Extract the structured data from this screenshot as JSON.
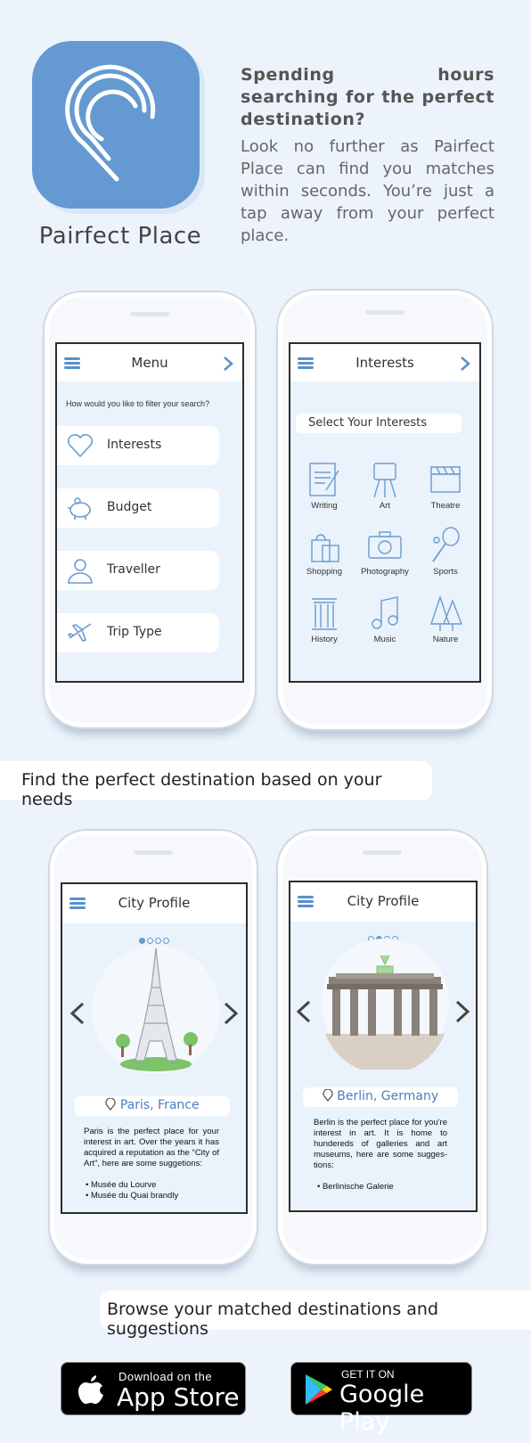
{
  "hero": {
    "app_name": "Pairfect Place",
    "headline": "Spending hours searching for the perfect destination?",
    "blurb": "Look no further as Pairfect Place can find you matches within seconds. You’re just a tap away from your perfect place."
  },
  "menu_screen": {
    "title": "Menu",
    "question": "How would you like to filter your search?",
    "items": [
      {
        "label": "Interests",
        "icon": "heart-icon"
      },
      {
        "label": "Budget",
        "icon": "piggy-bank-icon"
      },
      {
        "label": "Traveller",
        "icon": "person-icon"
      },
      {
        "label": "Trip Type",
        "icon": "airplane-icon"
      }
    ]
  },
  "interests_screen": {
    "title": "Interests",
    "select_label": "Select Your Interests",
    "items": [
      {
        "label": "Writing",
        "icon": "writing-icon"
      },
      {
        "label": "Art",
        "icon": "easel-icon"
      },
      {
        "label": "Theatre",
        "icon": "clapperboard-icon"
      },
      {
        "label": "Shopping",
        "icon": "shopping-bag-icon"
      },
      {
        "label": "Photography",
        "icon": "camera-icon"
      },
      {
        "label": "Sports",
        "icon": "tennis-racket-icon"
      },
      {
        "label": "History",
        "icon": "column-icon"
      },
      {
        "label": "Music",
        "icon": "music-note-icon"
      },
      {
        "label": "Nature",
        "icon": "tree-icon"
      }
    ]
  },
  "banner1": "Find the perfect destination based on your needs",
  "city1": {
    "title": "City Profile",
    "city": "Paris, France",
    "description": "Paris is the perfect place for your interest in art. Over the years it has acquired a reputation as the “City of Art”, here are some suggetions:",
    "suggestions": [
      "Musée du Lourve",
      "Musée du Quai brandly"
    ]
  },
  "city2": {
    "title": "City Profile",
    "city": "Berlin, Germany",
    "description": "Berlin is the perfect place for you're interest in art. It is home to hundereds of galleries and art museums, here are some sugges- tions:",
    "suggestions": [
      "Berlinische Galerie"
    ]
  },
  "banner2": "Browse your matched destinations and suggestions",
  "stores": {
    "apple_small": "Download on the",
    "apple_big": "App Store",
    "google_small": "GET IT ON",
    "google_big": "Google Play"
  },
  "colors": {
    "accent": "#6499d1",
    "background": "#ecf3fb"
  }
}
